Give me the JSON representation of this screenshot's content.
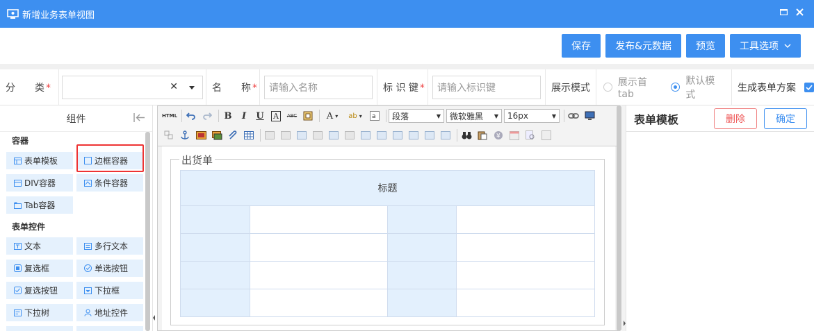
{
  "window": {
    "title": "新增业务表单视图",
    "icons": {
      "app": "monitor-icon",
      "maximize": "maximize-icon",
      "close": "close-icon"
    },
    "colors": {
      "primary": "#3d8ff0",
      "danger": "#e55555",
      "panel_item": "#e5f1fd"
    }
  },
  "actions": {
    "save": "保存",
    "publish": "发布&元数据",
    "preview": "预览",
    "tools": "工具选项"
  },
  "form": {
    "category_label": "分　　类",
    "category_value": "",
    "name_label": "名　　称",
    "name_placeholder": "请输入名称",
    "key_label": "标 识 键",
    "key_placeholder": "请输入标识键",
    "display_mode_label": "展示模式",
    "display_options": [
      {
        "label": "展示首tab",
        "checked": false
      },
      {
        "label": "默认模式",
        "checked": true
      }
    ],
    "generate_label": "生成表单方案",
    "generate_checked": true,
    "required_mark": "*"
  },
  "components": {
    "header": "组件",
    "sections": [
      {
        "title": "容器",
        "items": [
          "表单模板",
          "边框容器",
          "DIV容器",
          "条件容器",
          "Tab容器"
        ]
      },
      {
        "title": "表单控件",
        "items": [
          "文本",
          "多行文本",
          "复选框",
          "单选按钮",
          "复选按钮",
          "下拉框",
          "下拉树",
          "地址控件"
        ]
      }
    ],
    "highlighted_item": "边框容器"
  },
  "toolbar": {
    "html_label": "HTML",
    "paragraph": "段落",
    "font_family": "微软雅黑",
    "font_size": "16px",
    "bold": "B",
    "italic": "I",
    "underline": "U",
    "font_color": "A",
    "strike": "ABC"
  },
  "document": {
    "legend": "出货单",
    "table_title": "标题",
    "rows": 4
  },
  "template_panel": {
    "title": "表单模板",
    "delete": "删除",
    "confirm": "确定"
  }
}
